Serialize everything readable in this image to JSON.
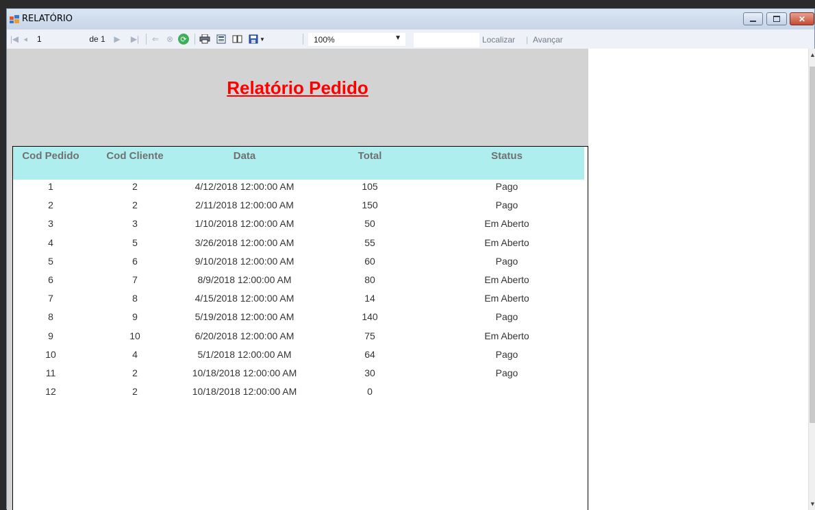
{
  "window": {
    "title": "RELATÓRIO"
  },
  "toolbar": {
    "first_page": "|◀",
    "prev_page": "◀",
    "current_page": "1",
    "of_label": "de 1",
    "next_page": "▶",
    "last_page": "▶|",
    "back": "⇐",
    "stop": "⊗",
    "refresh": "⟳",
    "zoom": "100%",
    "find_label": "Localizar",
    "next_label": "Avançar"
  },
  "report": {
    "title": "Relatório Pedido",
    "columns": [
      "Cod Pedido",
      "Cod Cliente",
      "Data",
      "Total",
      "Status"
    ],
    "rows": [
      [
        "1",
        "2",
        "4/12/2018 12:00:00 AM",
        "105",
        "Pago"
      ],
      [
        "2",
        "2",
        "2/11/2018 12:00:00 AM",
        "150",
        "Pago"
      ],
      [
        "3",
        "3",
        "1/10/2018 12:00:00 AM",
        "50",
        "Em Aberto"
      ],
      [
        "4",
        "5",
        "3/26/2018 12:00:00 AM",
        "55",
        "Em Aberto"
      ],
      [
        "5",
        "6",
        "9/10/2018 12:00:00 AM",
        "60",
        "Pago"
      ],
      [
        "6",
        "7",
        "8/9/2018 12:00:00 AM",
        "80",
        "Em Aberto"
      ],
      [
        "7",
        "8",
        "4/15/2018 12:00:00 AM",
        "14",
        "Em Aberto"
      ],
      [
        "8",
        "9",
        "5/19/2018 12:00:00 AM",
        "140",
        "Pago"
      ],
      [
        "9",
        "10",
        "6/20/2018 12:00:00 AM",
        "75",
        "Em Aberto"
      ],
      [
        "10",
        "4",
        "5/1/2018 12:00:00 AM",
        "64",
        "Pago"
      ],
      [
        "11",
        "2",
        "10/18/2018 12:00:00 AM",
        "30",
        "Pago"
      ],
      [
        "12",
        "2",
        "10/18/2018 12:00:00 AM",
        "0",
        ""
      ]
    ]
  },
  "colors": {
    "title_red": "#ff0000",
    "header_cyan": "#afeeee",
    "report_bg": "#d3d3d3"
  }
}
